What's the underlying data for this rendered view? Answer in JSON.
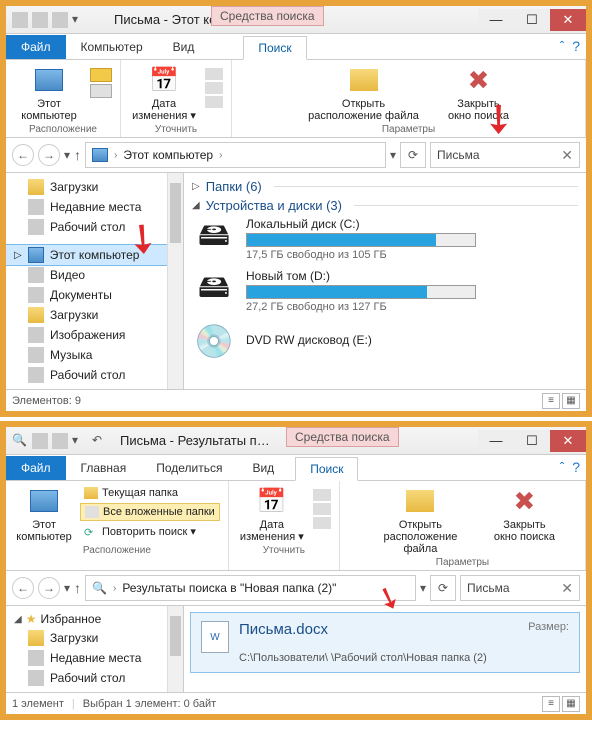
{
  "win1": {
    "title": "Письма - Этот комп…",
    "searchToolsLabel": "Средства поиска",
    "tabs": {
      "file": "Файл",
      "computer": "Компьютер",
      "view": "Вид",
      "search": "Поиск"
    },
    "ribbon": {
      "thisPC": "Этот\nкомпьютер",
      "date": "Дата\nизменения ▾",
      "openLoc": "Открыть\nрасположение файла",
      "closeSearch": "Закрыть\nокно поиска",
      "groupLoc": "Расположение",
      "groupRefine": "Уточнить",
      "groupParams": "Параметры"
    },
    "breadcrumb": {
      "seg1": "Этот компьютер"
    },
    "search": {
      "value": "Письма"
    },
    "nav": {
      "downloads": "Загрузки",
      "recent": "Недавние места",
      "desktop": "Рабочий стол",
      "thisPC": "Этот компьютер",
      "videos": "Видео",
      "documents": "Документы",
      "downloads2": "Загрузки",
      "pictures": "Изображения",
      "music": "Музыка",
      "desktop2": "Рабочий стол"
    },
    "content": {
      "folders": "Папки (6)",
      "devices": "Устройства и диски (3)",
      "driveC": {
        "name": "Локальный диск (C:)",
        "sub": "17,5 ГБ свободно из 105 ГБ",
        "fillPct": 83
      },
      "driveD": {
        "name": "Новый том (D:)",
        "sub": "27,2 ГБ свободно из 127 ГБ",
        "fillPct": 79
      },
      "dvd": {
        "name": "DVD RW дисковод (E:)"
      }
    },
    "status": "Элементов: 9"
  },
  "win2": {
    "title": "Письма - Результаты п…",
    "searchToolsLabel": "Средства поиска",
    "tabs": {
      "file": "Файл",
      "home": "Главная",
      "share": "Поделиться",
      "view": "Вид",
      "search": "Поиск"
    },
    "ribbon": {
      "thisPC": "Этот\nкомпьютер",
      "curFolder": "Текущая папка",
      "allSub": "Все вложенные папки",
      "repeat": "Повторить поиск ▾",
      "date": "Дата\nизменения ▾",
      "openLoc": "Открыть\nрасположение файла",
      "closeSearch": "Закрыть\nокно поиска",
      "groupLoc": "Расположение",
      "groupRefine": "Уточнить",
      "groupParams": "Параметры"
    },
    "breadcrumb": {
      "label": "Результаты поиска в \"Новая папка (2)\""
    },
    "search": {
      "value": "Письма"
    },
    "nav": {
      "fav": "Избранное",
      "downloads": "Загрузки",
      "recent": "Недавние места",
      "desktop": "Рабочий стол"
    },
    "result": {
      "title": "Письма.docx",
      "sizeLabel": "Размер:",
      "path": "C:\\Пользователи\\            \\Рабочий стол\\Новая папка (2)"
    },
    "status1": "1 элемент",
    "status2": "Выбран 1 элемент: 0 байт"
  }
}
